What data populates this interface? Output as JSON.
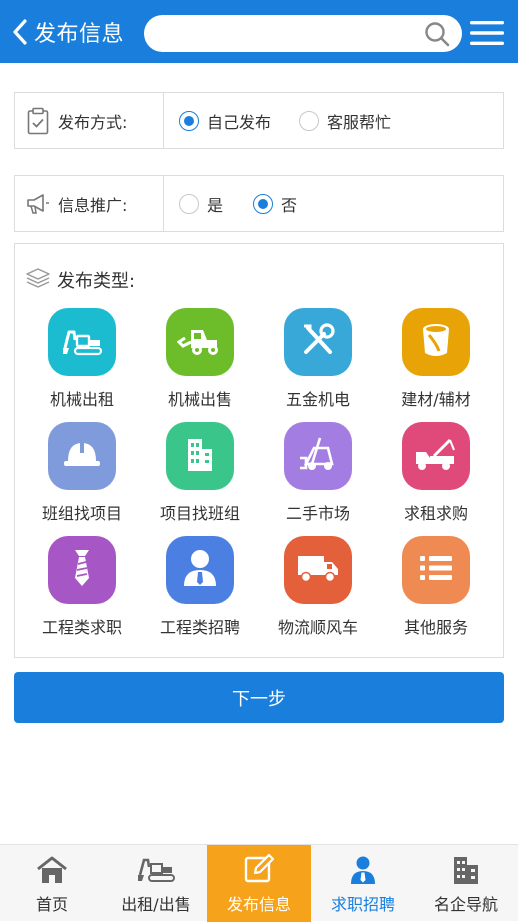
{
  "header": {
    "title": "发布信息",
    "search_placeholder": "",
    "back_icon": "chevron-left-icon",
    "search_icon": "search-icon",
    "menu_icon": "hamburger-menu-icon",
    "bg_color": "#1a7fdc"
  },
  "publish_method": {
    "label": "发布方式:",
    "icon": "clipboard-icon",
    "options": [
      {
        "label": "自己发布",
        "checked": true
      },
      {
        "label": "客服帮忙",
        "checked": false
      }
    ]
  },
  "promotion": {
    "label": "信息推广:",
    "icon": "megaphone-icon",
    "options": [
      {
        "label": "是",
        "checked": false
      },
      {
        "label": "否",
        "checked": true
      }
    ]
  },
  "types": {
    "title": "发布类型:",
    "icon": "layers-icon",
    "items": [
      {
        "label": "机械出租",
        "icon": "excavator-icon",
        "color": "#1bbbd0"
      },
      {
        "label": "机械出售",
        "icon": "loader-icon",
        "color": "#6dbd2a"
      },
      {
        "label": "五金机电",
        "icon": "tools-icon",
        "color": "#37a8d8"
      },
      {
        "label": "建材/辅材",
        "icon": "paint-bucket-icon",
        "color": "#e8a407"
      },
      {
        "label": "班组找项目",
        "icon": "hard-hat-icon",
        "color": "#7f9bdb"
      },
      {
        "label": "项目找班组",
        "icon": "building-icon",
        "color": "#3ac68a"
      },
      {
        "label": "二手市场",
        "icon": "forklift-icon",
        "color": "#a47de3"
      },
      {
        "label": "求租求购",
        "icon": "crane-truck-icon",
        "color": "#e04a7a"
      },
      {
        "label": "工程类求职",
        "icon": "tie-icon",
        "color": "#a757c5"
      },
      {
        "label": "工程类招聘",
        "icon": "person-icon",
        "color": "#4b80e2"
      },
      {
        "label": "物流顺风车",
        "icon": "truck-icon",
        "color": "#e3603b"
      },
      {
        "label": "其他服务",
        "icon": "list-icon",
        "color": "#ef8a53"
      }
    ]
  },
  "next_button": "下一步",
  "bottom_nav": [
    {
      "label": "首页",
      "icon": "home-icon",
      "state": "normal"
    },
    {
      "label": "出租/出售",
      "icon": "excavator-icon",
      "state": "normal"
    },
    {
      "label": "发布信息",
      "icon": "edit-icon",
      "state": "active"
    },
    {
      "label": "求职招聘",
      "icon": "person-icon",
      "state": "blue"
    },
    {
      "label": "名企导航",
      "icon": "building-icon",
      "state": "normal"
    }
  ]
}
